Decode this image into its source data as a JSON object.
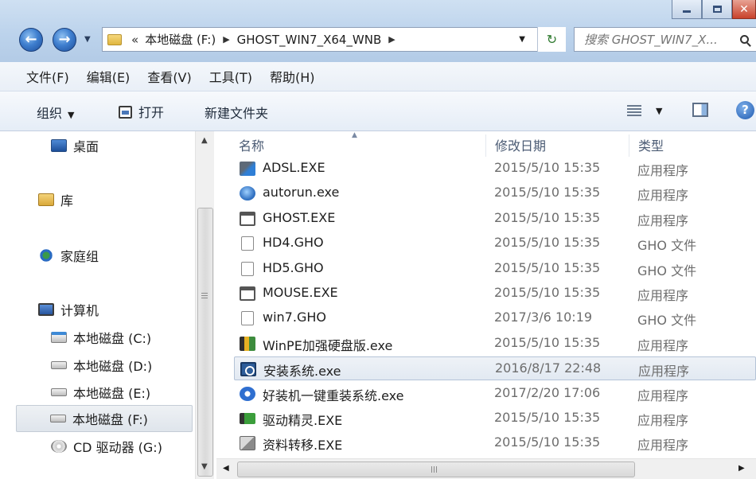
{
  "window": {
    "minimize_glyph": "",
    "close_glyph": "✕"
  },
  "nav": {
    "back_glyph": "←",
    "forward_glyph": "→",
    "recent_glyph": "▼"
  },
  "address": {
    "overflow_glyph": "«",
    "crumbs": [
      "本地磁盘 (F:)",
      "GHOST_WIN7_X64_WNB"
    ],
    "sep_glyph": "▶",
    "dropdown_glyph": "▼",
    "refresh_glyph": "↻"
  },
  "search": {
    "placeholder": "搜索 GHOST_WIN7_X..."
  },
  "menu": {
    "items": [
      "文件(F)",
      "编辑(E)",
      "查看(V)",
      "工具(T)",
      "帮助(H)"
    ]
  },
  "commands": {
    "organize": "组织",
    "open": "打开",
    "new_folder": "新建文件夹",
    "dropdown_glyph": "▼",
    "help_glyph": "?"
  },
  "navpane": {
    "desktop": "桌面",
    "library": "库",
    "homegroup": "家庭组",
    "computer": "计算机",
    "drive_c": "本地磁盘 (C:)",
    "drive_d": "本地磁盘 (D:)",
    "drive_e": "本地磁盘 (E:)",
    "drive_f": "本地磁盘 (F:)",
    "drive_g": "CD 驱动器 (G:)",
    "scroll_up": "▲",
    "scroll_down": "▼"
  },
  "columns": {
    "name": "名称",
    "modified": "修改日期",
    "type": "类型",
    "sort_glyph": "▲"
  },
  "files": [
    {
      "icon": "network-exe-icon",
      "name": "ADSL.EXE",
      "date": "2015/5/10 15:35",
      "type": "应用程序"
    },
    {
      "icon": "autorun-icon",
      "name": "autorun.exe",
      "date": "2015/5/10 15:35",
      "type": "应用程序"
    },
    {
      "icon": "window-exe-icon",
      "name": "GHOST.EXE",
      "date": "2015/5/10 15:35",
      "type": "应用程序"
    },
    {
      "icon": "blank-file-icon",
      "name": "HD4.GHO",
      "date": "2015/5/10 15:35",
      "type": "GHO 文件"
    },
    {
      "icon": "blank-file-icon",
      "name": "HD5.GHO",
      "date": "2015/5/10 15:35",
      "type": "GHO 文件"
    },
    {
      "icon": "window-exe-icon",
      "name": "MOUSE.EXE",
      "date": "2015/5/10 15:35",
      "type": "应用程序"
    },
    {
      "icon": "blank-file-icon",
      "name": "win7.GHO",
      "date": "2017/3/6 10:19",
      "type": "GHO 文件"
    },
    {
      "icon": "winpe-icon",
      "name": "WinPE加强硬盘版.exe",
      "date": "2015/5/10 15:35",
      "type": "应用程序"
    },
    {
      "icon": "setup-icon",
      "name": "安装系统.exe",
      "date": "2016/8/17 22:48",
      "type": "应用程序"
    },
    {
      "icon": "haozhuangji-icon",
      "name": "好装机一键重装系统.exe",
      "date": "2017/2/20 17:06",
      "type": "应用程序"
    },
    {
      "icon": "driver-icon",
      "name": "驱动精灵.EXE",
      "date": "2015/5/10 15:35",
      "type": "应用程序"
    },
    {
      "icon": "migrate-icon",
      "name": "资料转移.EXE",
      "date": "2015/5/10 15:35",
      "type": "应用程序"
    }
  ],
  "selected_file": "安装系统.exe",
  "hscroll": {
    "left_glyph": "◀",
    "right_glyph": "▶"
  }
}
